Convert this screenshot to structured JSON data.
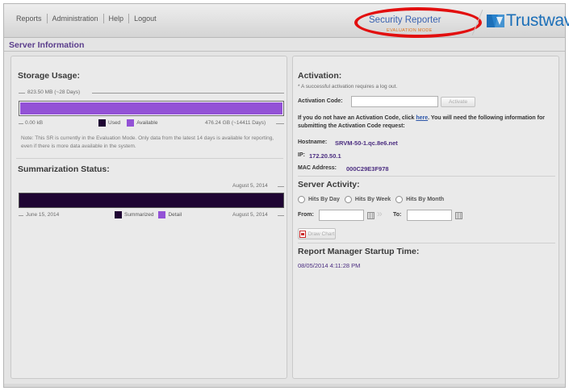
{
  "menu": {
    "reports": "Reports",
    "administration": "Administration",
    "help": "Help",
    "logout": "Logout"
  },
  "brand": {
    "product": "Security Reporter",
    "mode": "EVALUATION MODE",
    "company": "Trustwave",
    "colors": {
      "product": "#3a62b0",
      "mode": "#e07822",
      "company": "#1c6fb8",
      "highlight_ellipse": "#e20f0f"
    }
  },
  "page": {
    "title": "Server Information"
  },
  "storage": {
    "heading": "Storage Usage:",
    "capacity_label": "823.50 MB (~28 Days)",
    "min_label": "0.00 kB",
    "max_label": "476.24 GB (~14411 Days)",
    "legend_used": "Used",
    "legend_available": "Available",
    "used_fraction": 0.0,
    "colors": {
      "used": "#1f0533",
      "available": "#9352d6"
    },
    "note": "Note: This SR is currently in the Evaluation Mode. Only data from the latest 14 days is available for reporting, even if there is more data available in the system."
  },
  "summarization": {
    "heading": "Summarization Status:",
    "top_date": "August 5, 2014",
    "start_date": "June 15, 2014",
    "end_date": "August 5, 2014",
    "legend_summarized": "Summarized",
    "legend_detail": "Detail",
    "summarized_fraction": 1.0,
    "colors": {
      "summarized": "#1f0533",
      "detail": "#9352d6"
    }
  },
  "activation": {
    "heading": "Activation:",
    "notice": "* A successful activation requires a log out.",
    "code_label": "Activation Code:",
    "code_value": "",
    "activate_button": "Activate",
    "info_prefix": "If you do not have an Activation Code, click ",
    "info_link": "here",
    "info_suffix": ". You will need the following information for submitting the Activation Code request:",
    "hostname_label": "Hostname:",
    "hostname": "SRVM-50-1.qc.8e6.net",
    "ip_label": "IP:",
    "ip": "172.20.50.1",
    "mac_label": "MAC Address:",
    "mac": "000C29E3F978"
  },
  "activity": {
    "heading": "Server Activity:",
    "options": [
      "Hits By Day",
      "Hits By Week",
      "Hits By Month"
    ],
    "from_label": "From:",
    "to_label": "To:",
    "from_value": "",
    "to_value": "",
    "draw_button": "Draw Chart"
  },
  "startup": {
    "heading": "Report Manager Startup Time:",
    "time": "08/05/2014 4:11:28 PM"
  }
}
